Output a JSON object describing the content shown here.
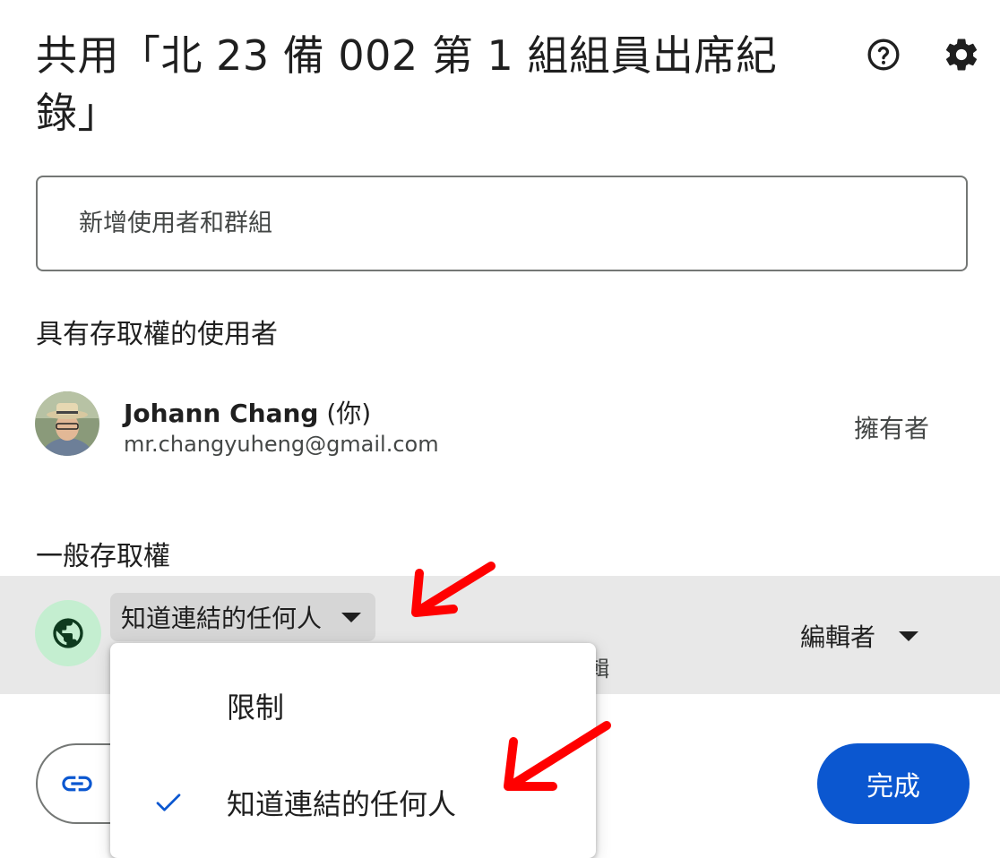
{
  "dialog": {
    "title": "共用「北 23 備 002 第 1 組組員出席紀錄」",
    "help_icon": "help-circle-icon",
    "settings_icon": "gear-icon"
  },
  "search": {
    "placeholder": "新增使用者和群組"
  },
  "people_section": {
    "title": "具有存取權的使用者",
    "users": [
      {
        "name": "Johann Chang",
        "you_suffix": "(你)",
        "email": "mr.changyuheng@gmail.com",
        "role": "擁有者"
      }
    ]
  },
  "general_access": {
    "title": "一般存取權",
    "selected_option": "知道連結的任何人",
    "obscured_text": "輯",
    "role": "編輯者",
    "icon": "globe-icon",
    "icon_bg_color": "#c4eed0",
    "row_bg_color": "#e8e8e8"
  },
  "dropdown_menu": {
    "options": [
      {
        "label": "限制",
        "checked": false
      },
      {
        "label": "知道連結的任何人",
        "checked": true
      }
    ],
    "check_color": "#0b57d0"
  },
  "footer": {
    "copy_link_icon": "link-icon",
    "done_label": "完成",
    "done_color": "#0b57d0"
  },
  "annotations": {
    "arrow_color": "#ff0000",
    "arrow_icon": "red-arrow-icon"
  }
}
